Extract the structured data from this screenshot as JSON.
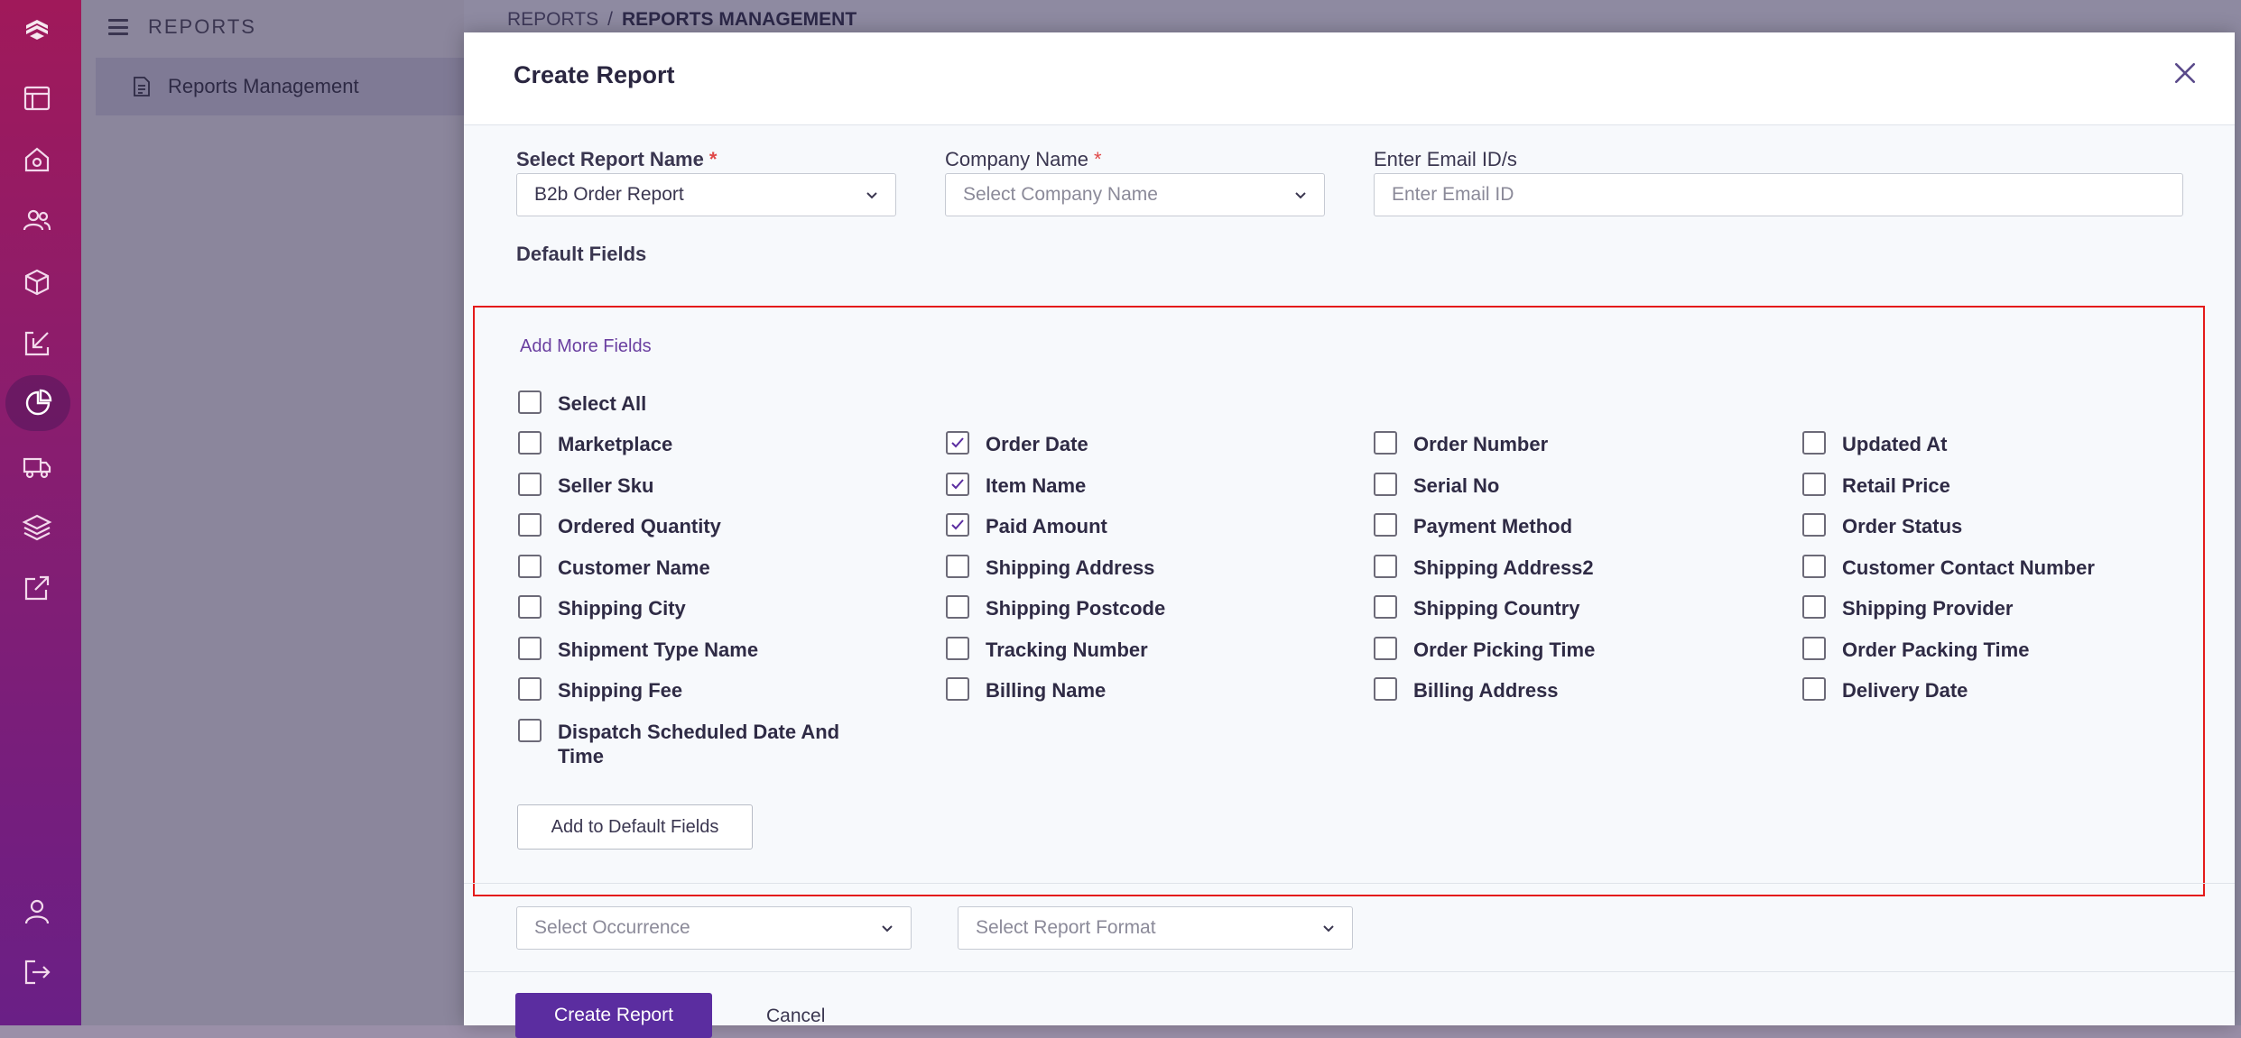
{
  "sidebar": {
    "section_title": "REPORTS",
    "items": [
      {
        "label": "Reports Management"
      }
    ]
  },
  "breadcrumb": {
    "parent": "REPORTS",
    "separator": "/",
    "current": "REPORTS MANAGEMENT"
  },
  "modal": {
    "title": "Create Report",
    "report_name": {
      "label": "Select Report Name",
      "required_mark": "*",
      "value": "B2b Order Report"
    },
    "company_name": {
      "label": "Company Name",
      "required_mark": "*",
      "placeholder": "Select Company Name"
    },
    "email": {
      "label": "Enter Email ID/s",
      "placeholder": "Enter Email ID"
    },
    "default_fields_title": "Default Fields",
    "add_more_fields": "Add More Fields",
    "select_all": {
      "label": "Select All",
      "checked": false
    },
    "fields": [
      {
        "label": "Marketplace",
        "checked": false
      },
      {
        "label": "Order Date",
        "checked": true
      },
      {
        "label": "Order Number",
        "checked": false
      },
      {
        "label": "Updated At",
        "checked": false
      },
      {
        "label": "Seller Sku",
        "checked": false
      },
      {
        "label": "Item Name",
        "checked": true
      },
      {
        "label": "Serial No",
        "checked": false
      },
      {
        "label": "Retail Price",
        "checked": false
      },
      {
        "label": "Ordered Quantity",
        "checked": false
      },
      {
        "label": "Paid Amount",
        "checked": true
      },
      {
        "label": "Payment Method",
        "checked": false
      },
      {
        "label": "Order Status",
        "checked": false
      },
      {
        "label": "Customer Name",
        "checked": false
      },
      {
        "label": "Shipping Address",
        "checked": false
      },
      {
        "label": "Shipping Address2",
        "checked": false
      },
      {
        "label": "Customer Contact Number",
        "checked": false
      },
      {
        "label": "Shipping City",
        "checked": false
      },
      {
        "label": "Shipping Postcode",
        "checked": false
      },
      {
        "label": "Shipping Country",
        "checked": false
      },
      {
        "label": "Shipping Provider",
        "checked": false
      },
      {
        "label": "Shipment Type Name",
        "checked": false
      },
      {
        "label": "Tracking Number",
        "checked": false
      },
      {
        "label": "Order Picking Time",
        "checked": false
      },
      {
        "label": "Order Packing Time",
        "checked": false
      },
      {
        "label": "Shipping Fee",
        "checked": false
      },
      {
        "label": "Billing Name",
        "checked": false
      },
      {
        "label": "Billing Address",
        "checked": false
      },
      {
        "label": "Delivery Date",
        "checked": false
      },
      {
        "label": "Dispatch Scheduled Date And Time",
        "checked": false
      }
    ],
    "add_to_default": "Add to Default Fields",
    "occurrence_placeholder": "Select Occurrence",
    "format_placeholder": "Select Report Format",
    "create_button": "Create Report",
    "cancel": "Cancel"
  },
  "colors": {
    "accent": "#5b2da0",
    "highlight_border": "#e41b1b",
    "rail_top": "#a0195a",
    "rail_bottom": "#6a1f86"
  },
  "rail_icons": [
    "logo-icon",
    "dashboard-icon",
    "home-icon",
    "users-icon",
    "box-icon",
    "inbound-icon",
    "reports-icon",
    "truck-icon",
    "layers-icon",
    "export-icon",
    "profile-icon",
    "logout-icon"
  ]
}
